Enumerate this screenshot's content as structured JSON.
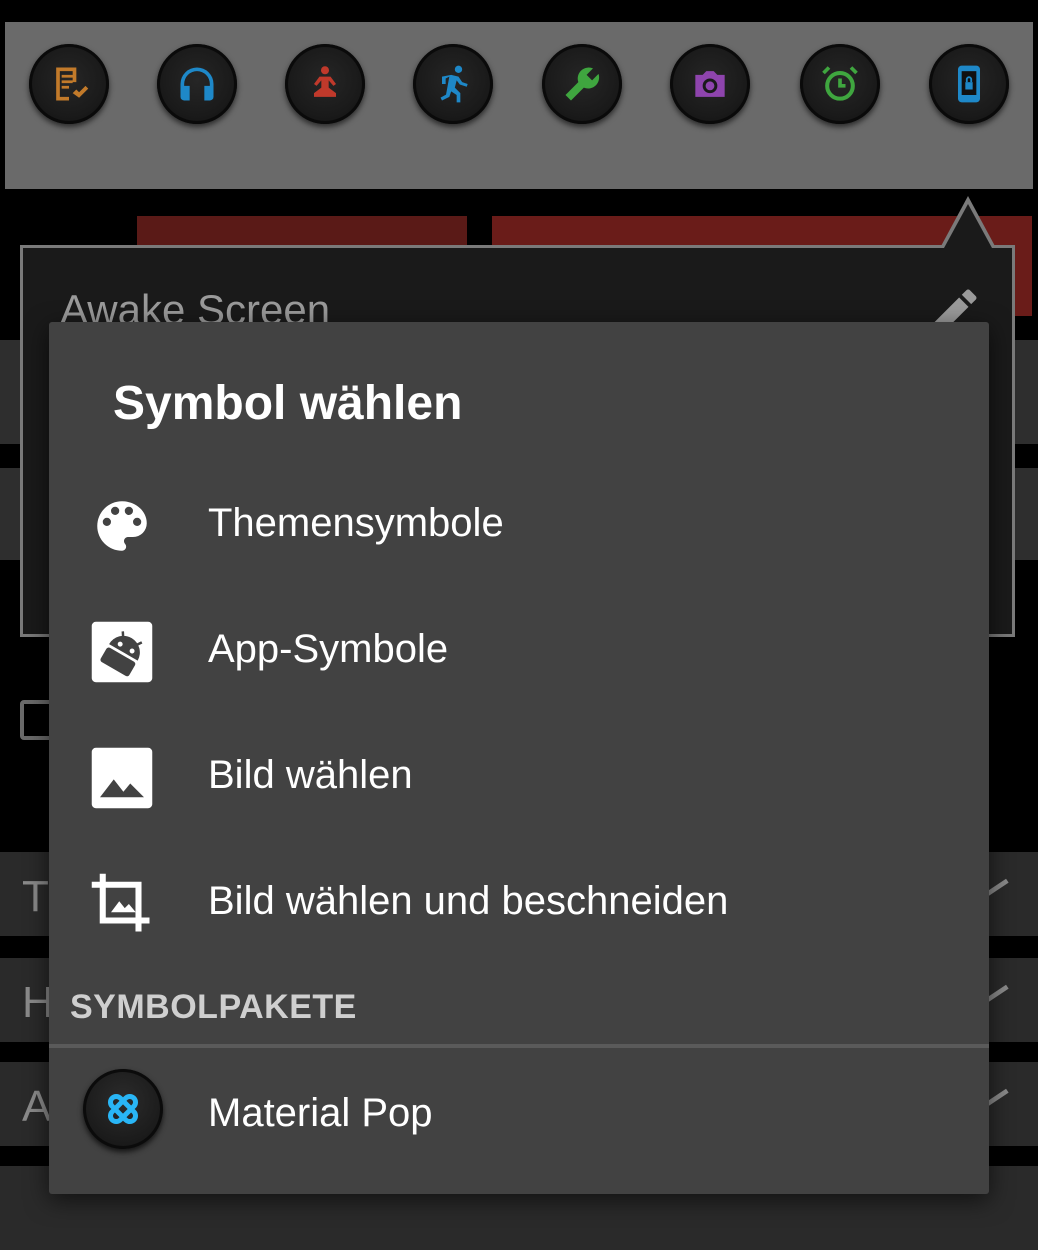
{
  "background": {
    "top_icons": [
      {
        "name": "checklist-icon",
        "color": "#c27a2a"
      },
      {
        "name": "headphones-icon",
        "color": "#1e88c8"
      },
      {
        "name": "meditation-icon",
        "color": "#c0392b"
      },
      {
        "name": "runner-icon",
        "color": "#1e88c8"
      },
      {
        "name": "wrench-icon",
        "color": "#3fa63f"
      },
      {
        "name": "camera-icon",
        "color": "#8e44ad"
      },
      {
        "name": "alarm-clock-icon",
        "color": "#3fa63f"
      },
      {
        "name": "phone-lock-icon",
        "color": "#1e88c8"
      }
    ],
    "widget_title": "Awake Screen",
    "row_letters": [
      "T",
      "H",
      "A"
    ]
  },
  "dialog": {
    "title": "Symbol wählen",
    "items": [
      {
        "label": "Themensymbole",
        "icon": "palette-icon"
      },
      {
        "label": "App-Symbole",
        "icon": "android-app-icon"
      },
      {
        "label": "Bild wählen",
        "icon": "image-icon"
      },
      {
        "label": "Bild wählen und beschneiden",
        "icon": "crop-image-icon"
      }
    ],
    "section_header": "SYMBOLPAKETE",
    "packs": [
      {
        "label": "Material Pop",
        "icon": "material-pop-icon",
        "color": "#29b6f6"
      }
    ]
  },
  "colors": {
    "dialog_bg": "#424242",
    "accent_red": "#6a1c19",
    "top_bar": "#6a6a6a"
  }
}
